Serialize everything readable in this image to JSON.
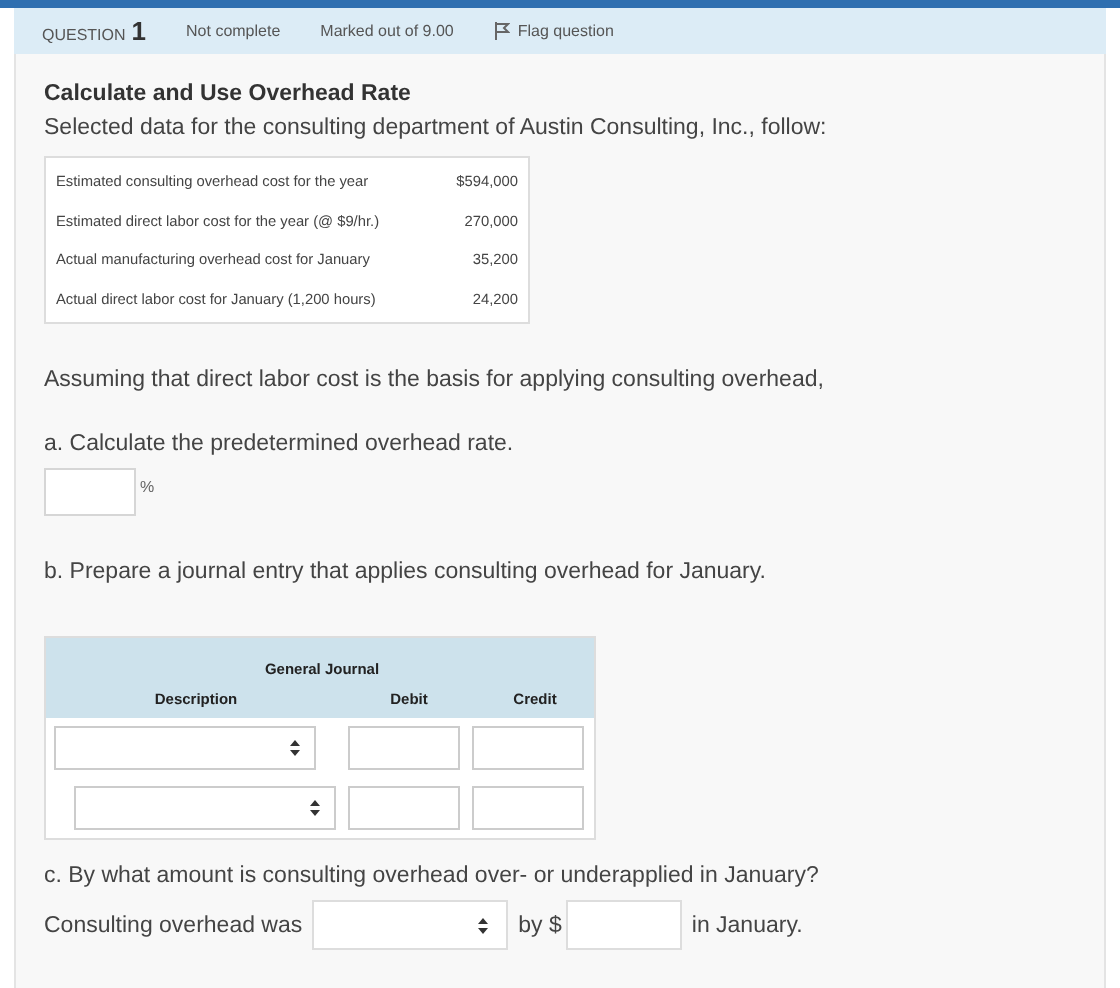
{
  "header": {
    "label": "QUESTION",
    "number": "1",
    "status": "Not complete",
    "marks": "Marked out of 9.00",
    "flag": "Flag question"
  },
  "title": "Calculate and Use Overhead Rate",
  "intro": "Selected data for the consulting department of Austin Consulting, Inc., follow:",
  "data_table": [
    {
      "label": "Estimated consulting overhead cost for the year",
      "value": "$594,000"
    },
    {
      "label": "Estimated direct labor cost for the year (@ $9/hr.)",
      "value": "270,000"
    },
    {
      "label": "Actual manufacturing overhead cost for January",
      "value": "35,200"
    },
    {
      "label": "Actual direct labor cost for January (1,200 hours)",
      "value": "24,200"
    }
  ],
  "assumption": "Assuming that direct labor cost is the basis for applying consulting overhead,",
  "part_a": {
    "prompt": "a. Calculate the predetermined overhead rate.",
    "unit": "%"
  },
  "part_b": {
    "prompt": "b. Prepare a journal entry that applies consulting overhead for January.",
    "journal": {
      "title": "General Journal",
      "columns": [
        "Description",
        "Debit",
        "Credit"
      ],
      "rows": [
        {
          "kind": "debit"
        },
        {
          "kind": "credit"
        }
      ]
    }
  },
  "part_c": {
    "prompt": "c. By what amount is consulting overhead over- or underapplied in January?",
    "lead": "Consulting overhead was",
    "by": "by $",
    "tail": "in January."
  }
}
